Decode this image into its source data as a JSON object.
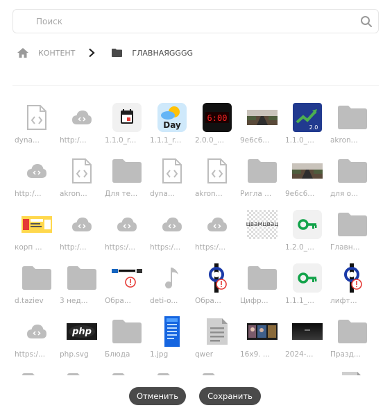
{
  "search": {
    "placeholder": "Поиск",
    "value": ""
  },
  "breadcrumb": {
    "root": "КОНТЕНТ",
    "current": "ГЛАВНАЯGGGG"
  },
  "files": [
    {
      "label": "dyna...",
      "icon": "code-file-icon"
    },
    {
      "label": "http:/...",
      "icon": "cloud-link-icon"
    },
    {
      "label": "1.1.0_r...",
      "icon": "calendar-app-image"
    },
    {
      "label": "1.1.1_r...",
      "icon": "weather-day-app-image"
    },
    {
      "label": "2.0.0_...",
      "icon": "digital-clock-image"
    },
    {
      "label": "9e6c6...",
      "icon": "road-photo-image"
    },
    {
      "label": "1.1.0_...",
      "icon": "growth-chart-app-image"
    },
    {
      "label": "akron...",
      "icon": "folder-icon"
    },
    {
      "label": "http:/...",
      "icon": "cloud-link-icon"
    },
    {
      "label": "akron...",
      "icon": "code-file-icon"
    },
    {
      "label": "Для те...",
      "icon": "folder-icon"
    },
    {
      "label": "dyna...",
      "icon": "code-file-icon"
    },
    {
      "label": "akron...",
      "icon": "code-file-icon"
    },
    {
      "label": "Ригла ...",
      "icon": "folder-icon"
    },
    {
      "label": "9e6c6...",
      "icon": "road-photo-image"
    },
    {
      "label": "для о...",
      "icon": "folder-icon"
    },
    {
      "label": "корп ...",
      "icon": "yellow-banner-image"
    },
    {
      "label": "http:/...",
      "icon": "cloud-link-icon"
    },
    {
      "label": "https:/...",
      "icon": "cloud-link-icon"
    },
    {
      "label": "https:/...",
      "icon": "cloud-link-icon"
    },
    {
      "label": "https:/...",
      "icon": "cloud-link-icon"
    },
    {
      "label": "",
      "icon": "transparent-text-image",
      "thumb_text": "цвамцвац"
    },
    {
      "label": "1.2.0_...",
      "icon": "green-key-app-image"
    },
    {
      "label": "Главн...",
      "icon": "folder-icon"
    },
    {
      "label": "d.taziev",
      "icon": "folder-icon"
    },
    {
      "label": "3 нед...",
      "icon": "folder-icon"
    },
    {
      "label": "Обра...",
      "icon": "broken-image-icon"
    },
    {
      "label": "deti-o...",
      "icon": "music-note-icon"
    },
    {
      "label": "Обра...",
      "icon": "timer-broken-image-icon"
    },
    {
      "label": "Цифр...",
      "icon": "folder-icon"
    },
    {
      "label": "1.1.1_...",
      "icon": "green-key-app-image"
    },
    {
      "label": "лифт...",
      "icon": "timer-broken-image-icon"
    },
    {
      "label": "https:/...",
      "icon": "cloud-link-icon"
    },
    {
      "label": "php.svg",
      "icon": "php-logo-image",
      "thumb_text": "php"
    },
    {
      "label": "Блюда",
      "icon": "folder-icon"
    },
    {
      "label": "1.jpg",
      "icon": "blue-phone-screenshot-image"
    },
    {
      "label": "qwer",
      "icon": "document-icon"
    },
    {
      "label": "16x9. ...",
      "icon": "dark-collage-image"
    },
    {
      "label": "2024-...",
      "icon": "dark-gradient-image"
    },
    {
      "label": "Празд...",
      "icon": "folder-icon"
    },
    {
      "label": "",
      "icon": "folder-icon"
    },
    {
      "label": "",
      "icon": "folder-icon"
    },
    {
      "label": "",
      "icon": "folder-icon"
    },
    {
      "label": "",
      "icon": "folder-icon"
    },
    {
      "label": "",
      "icon": "folder-icon"
    },
    {
      "label": "",
      "icon": "dark-collage-image"
    },
    {
      "label": "",
      "icon": "dark-gradient-image"
    },
    {
      "label": "",
      "icon": "document-icon"
    }
  ],
  "buttons": {
    "cancel": "Отменить",
    "save": "Сохранить"
  },
  "colors": {
    "icon_gray": "#bdbdbd",
    "label_gray": "#aaaaaa",
    "button_bg": "#4a4a4a",
    "button_text": "#ffffff"
  }
}
